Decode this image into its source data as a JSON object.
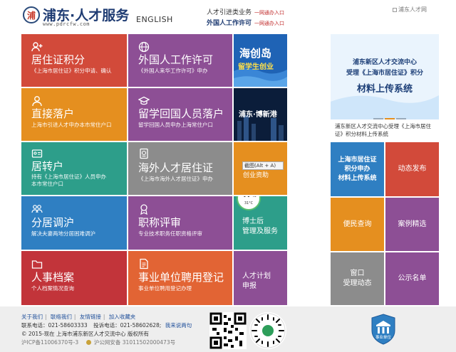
{
  "header": {
    "logo_char": "浦",
    "logo_name": "浦东·人才服务",
    "logo_url": "www.pdrcfw.com",
    "english": "ENGLISH",
    "links": [
      {
        "label": "人才引进类业务",
        "go": "一网通办入口"
      },
      {
        "label": "外国人工作许可",
        "go": "一网通办入口"
      }
    ],
    "broken_image_alt": "浦东人才网"
  },
  "tiles": [
    {
      "title": "居住证积分",
      "subtitle": "《上海市居住证》积分申请、确认",
      "color": "#d24a3a",
      "icon": "plus-user-icon"
    },
    {
      "title": "外国人工作许可",
      "subtitle": "《外国人来华工作许可》申办",
      "color": "#8d4f95",
      "icon": "globe-icon"
    },
    {
      "title": "直接落户",
      "subtitle": "上海市引进人才申办本市常住户口",
      "color": "#e58f1f",
      "icon": "user-icon"
    },
    {
      "title": "留学回国人员落户",
      "subtitle": "留学回国人员申办上海常住户口",
      "color": "#8d4f95",
      "icon": "graduate-icon"
    },
    {
      "title": "居转户",
      "subtitle": "持有《上海市居住证》人员申办本市常住户口",
      "color": "#2d9e8a",
      "icon": "id-card-icon"
    },
    {
      "title": "海外人才居住证",
      "subtitle": "《上海市海外人才居住证》申办",
      "color": "#8c8c8c",
      "icon": "passport-icon"
    },
    {
      "title": "分居调沪",
      "subtitle": "解决夫妻两地分居困难调沪",
      "color": "#2f7fc2",
      "icon": "people-icon"
    },
    {
      "title": "职称评审",
      "subtitle": "专业技术职务任职资格评审",
      "color": "#8d4f95",
      "icon": "medal-icon"
    },
    {
      "title": "人事档案",
      "subtitle": "个人档案情况查询",
      "color": "#c2343a",
      "icon": "folder-icon"
    },
    {
      "title": "事业单位聘用登记",
      "subtitle": "事业单位聘用登记办理",
      "color": "#e26434",
      "icon": "document-icon"
    }
  ],
  "middle": {
    "banner1_title": "海创岛",
    "banner1_sub": "留学生创业",
    "banner2_title": "浦东·博新港",
    "tooltip": "截图(Alt + A)",
    "chuangye": "创业资助",
    "battery_pct": "47",
    "battery_unit": "%",
    "battery_temp": "31°C",
    "postdoc": [
      "博士后",
      "管理及服务"
    ],
    "talent_plan": [
      "人才计划",
      "申报"
    ]
  },
  "right": {
    "banner_line1": "浦东新区人才交流中心",
    "banner_line2": "受理《上海市居住证》积分",
    "banner_line3": "材料上传系统",
    "caption": "浦东新区人才交流中心受理《上海市居住证》积分材料上传系统",
    "tiles": [
      {
        "label": "上海市居住证积分申办材料上传系统",
        "lines": [
          "上海市居住证",
          "积分申办",
          "材料上传系统"
        ],
        "color": "#2f7fc2"
      },
      {
        "label": "动态发布",
        "lines": [
          "动态发布"
        ],
        "color": "#d24a3a"
      },
      {
        "label": "便民查询",
        "lines": [
          "便民查询"
        ],
        "color": "#e58f1f"
      },
      {
        "label": "案例精选",
        "lines": [
          "案例精选"
        ],
        "color": "#8d4f95"
      },
      {
        "label": "窗口受理动态",
        "lines": [
          "窗口",
          "受理动态"
        ],
        "color": "#8c8c8c"
      },
      {
        "label": "公示名单",
        "lines": [
          "公示名单"
        ],
        "color": "#8d4f95"
      }
    ]
  },
  "footer": {
    "links": [
      "关于我们",
      "联络我们",
      "友情链接",
      "加入收藏夹"
    ],
    "phone_label": "联系电话：",
    "phone": "021-58603333",
    "complaint_label": "投诉电话：",
    "complaint": "021-58602628;",
    "feedback": "我来说两句",
    "copyright": "© 2015-现在 上海市浦东新区人才交流中心 版权所有",
    "icp": "沪ICP备11006370号-3",
    "police": "沪公网安备 31011502000473号",
    "badge": "事业单位"
  }
}
